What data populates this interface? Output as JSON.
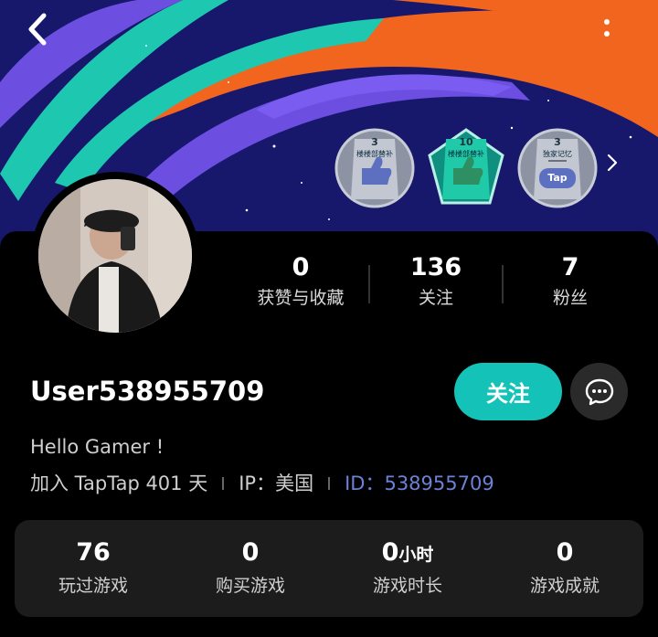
{
  "header": {
    "back_icon": "chevron-left-icon",
    "more_icon": "more-vertical-icon"
  },
  "badges": [
    {
      "count": "3",
      "label": "楼楼部替补",
      "color": "#b0b4c0",
      "icon": "thumbs-up-icon"
    },
    {
      "count": "10",
      "label": "楼楼部替补",
      "color": "#14c2a8",
      "icon": "thumbs-up-icon"
    },
    {
      "count": "3",
      "label": "独家记忆",
      "color": "#b0b4c0",
      "icon": "gamepad-tap-icon",
      "icon_text": "Tap"
    }
  ],
  "profile": {
    "username": "User538955709",
    "bio": "Hello Gamer !",
    "joined": "加入 TapTap 401 天",
    "ip_label": "IP：",
    "ip_value": "美国",
    "id_label": "ID：",
    "id_value": "538955709"
  },
  "stats": [
    {
      "value": "0",
      "label": "获赞与收藏"
    },
    {
      "value": "136",
      "label": "关注"
    },
    {
      "value": "7",
      "label": "粉丝"
    }
  ],
  "actions": {
    "follow_label": "关注",
    "chat_icon": "chat-bubble-icon"
  },
  "game_stats": [
    {
      "value": "76",
      "unit": "",
      "label": "玩过游戏"
    },
    {
      "value": "0",
      "unit": "",
      "label": "购买游戏"
    },
    {
      "value": "0",
      "unit": "小时",
      "label": "游戏时长"
    },
    {
      "value": "0",
      "unit": "",
      "label": "游戏成就"
    }
  ],
  "colors": {
    "accent": "#14c2b7",
    "id_link": "#6b82d6",
    "background": "#000000",
    "panel": "#1c1c1c"
  }
}
